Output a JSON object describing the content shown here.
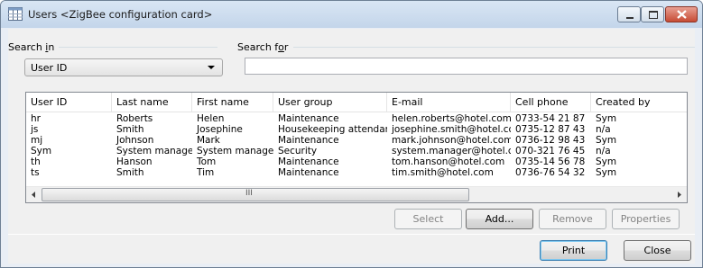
{
  "window": {
    "title": "Users <ZigBee configuration card>"
  },
  "search_in": {
    "label_pre": "Search ",
    "label_u": "i",
    "label_post": "n",
    "selected": "User ID"
  },
  "search_for": {
    "label_pre": "Search f",
    "label_u": "o",
    "label_post": "r",
    "value": ""
  },
  "table": {
    "columns": [
      "User ID",
      "Last name",
      "First name",
      "User group",
      "E-mail",
      "Cell phone",
      "Created by"
    ],
    "rows": [
      [
        "hr",
        "Roberts",
        "Helen",
        "Maintenance",
        "helen.roberts@hotel.com",
        "0733-54 21 87",
        "Sym"
      ],
      [
        "js",
        "Smith",
        "Josephine",
        "Housekeeping attendants",
        "josephine.smith@hotel.com",
        "0735-12 87 43",
        "n/a"
      ],
      [
        "mj",
        "Johnson",
        "Mark",
        "Maintenance",
        "mark.johnson@hotel.com",
        "0736-12 98 43",
        "Sym"
      ],
      [
        "Sym",
        "System manager",
        "System manager",
        "Security",
        "system.manager@hotel.com",
        "070-321 76 45",
        "n/a"
      ],
      [
        "th",
        "Hanson",
        "Tom",
        "Maintenance",
        "tom.hanson@hotel.com",
        "0735-14 56 78",
        "Sym"
      ],
      [
        "ts",
        "Smith",
        "Tim",
        "Maintenance",
        "tim.smith@hotel.com",
        "0736-76 54 32",
        "Sym"
      ]
    ],
    "scroll_grip": "III"
  },
  "buttons": {
    "select": "Select",
    "add": "Add...",
    "remove": "Remove",
    "properties": "Properties",
    "print": "Print",
    "close": "Close"
  },
  "colors": {
    "titlebar": "#c3d5ea",
    "close_button": "#c74b34",
    "window_bg": "#f0f0f0"
  }
}
